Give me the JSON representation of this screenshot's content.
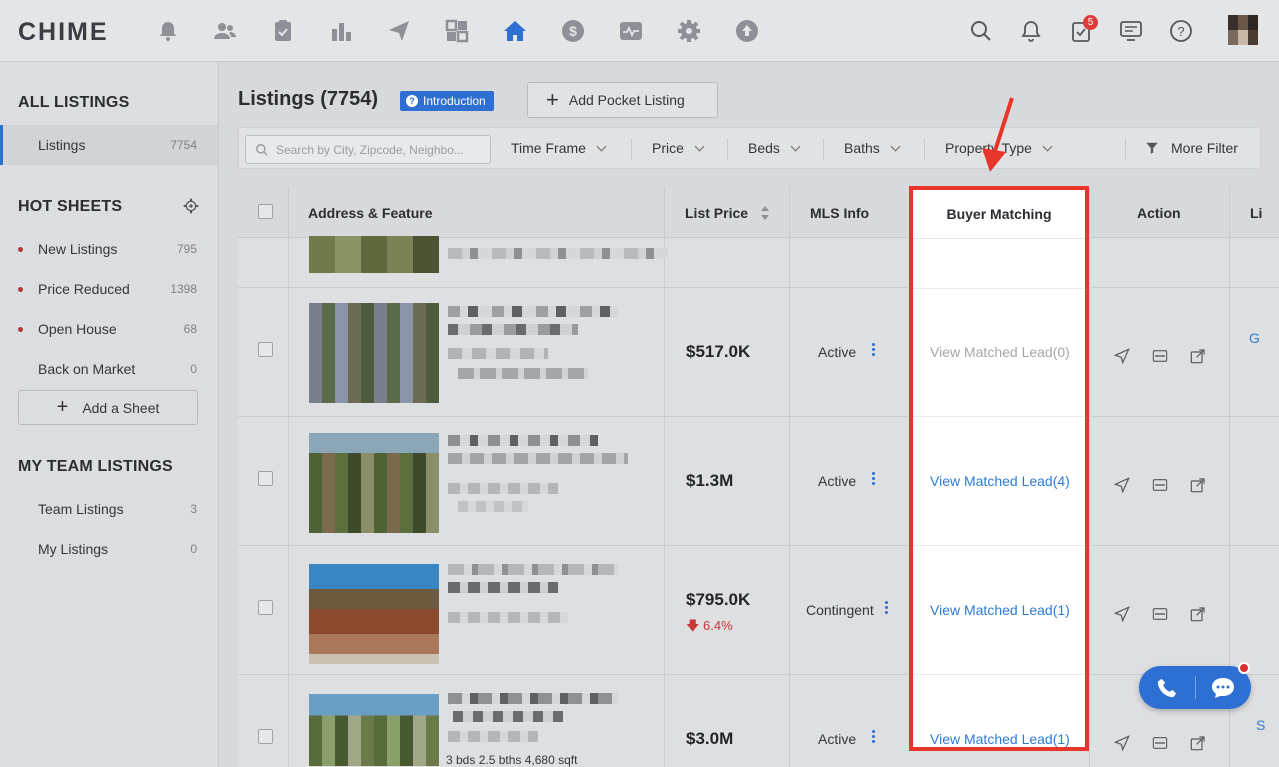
{
  "app": {
    "logo": "CHIME"
  },
  "nav": {
    "icons": [
      "alert-bell-dollar-icon",
      "people-icon",
      "clipboard-check-icon",
      "bar-chart-icon",
      "paper-plane-icon",
      "dashboard-grid-icon",
      "home-icon",
      "dollar-icon",
      "activity-icon",
      "gear-icon",
      "upload-icon"
    ],
    "right_icons": [
      "search-icon",
      "bell-icon",
      "tasks-icon",
      "monitor-icon",
      "help-icon"
    ],
    "tasks_badge": "5"
  },
  "sidebar": {
    "all_listings": {
      "heading": "ALL LISTINGS",
      "items": [
        {
          "label": "Listings",
          "count": "7754"
        }
      ]
    },
    "hot_sheets": {
      "heading": "HOT SHEETS",
      "items": [
        {
          "label": "New Listings",
          "count": "795"
        },
        {
          "label": "Price Reduced",
          "count": "1398"
        },
        {
          "label": "Open House",
          "count": "68"
        },
        {
          "label": "Back on Market",
          "count": "0"
        }
      ],
      "add_label": "Add a Sheet"
    },
    "team": {
      "heading": "MY TEAM LISTINGS",
      "items": [
        {
          "label": "Team Listings",
          "count": "3"
        },
        {
          "label": "My Listings",
          "count": "0"
        }
      ]
    }
  },
  "main": {
    "title": "Listings (7754)",
    "intro_label": "Introduction",
    "add_pocket_label": "Add Pocket Listing",
    "search_placeholder": "Search by City, Zipcode, Neighbo...",
    "filters": [
      "Time Frame",
      "Price",
      "Beds",
      "Baths",
      "Property Type"
    ],
    "more_filter": "More Filter"
  },
  "table": {
    "headers": {
      "address": "Address & Feature",
      "price": "List Price",
      "mls": "MLS Info",
      "buyer": "Buyer Matching",
      "action": "Action",
      "extra": "Li"
    },
    "rows": [
      {
        "price": "$517.0K",
        "drop": "",
        "status": "Active",
        "buyer": "View Matched Lead(0)",
        "features": ""
      },
      {
        "price": "$1.3M",
        "drop": "",
        "status": "Active",
        "buyer": "View Matched Lead(4)",
        "features": ""
      },
      {
        "price": "$795.0K",
        "drop": "6.4%",
        "status": "Contingent",
        "buyer": "View Matched Lead(1)",
        "features": ""
      },
      {
        "price": "$3.0M",
        "drop": "",
        "status": "Active",
        "buyer": "View Matched Lead(1)",
        "features": "3 bds 2.5 bths 4,680 sqft"
      }
    ],
    "right_edge": [
      "G",
      "S"
    ]
  },
  "colors": {
    "accent": "#2d6fd3",
    "highlight_border": "#e8352a",
    "link": "#2e7bd6",
    "price_drop": "#c9353a"
  }
}
